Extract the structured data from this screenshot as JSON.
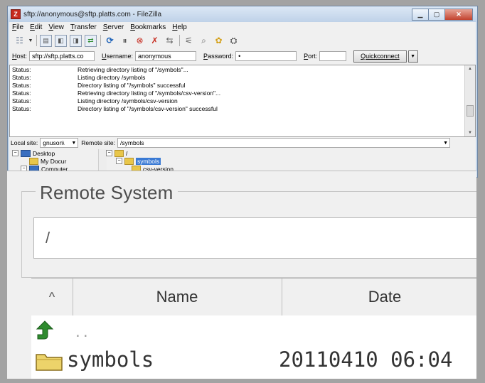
{
  "window": {
    "title": "sftp://anonymous@sftp.platts.com - FileZilla",
    "app_icon_letter": "Z"
  },
  "menu": [
    "File",
    "Edit",
    "View",
    "Transfer",
    "Server",
    "Bookmarks",
    "Help"
  ],
  "connect": {
    "host_label": "Host:",
    "host_value": "sftp://sftp.platts.co",
    "user_label": "Username:",
    "user_value": "anonymous",
    "pass_label": "Password:",
    "pass_value": "•",
    "port_label": "Port:",
    "port_value": "",
    "quickconnect_label": "Quickconnect"
  },
  "log": [
    {
      "k": "Status:",
      "v": "Retrieving directory listing of \"/symbols\"..."
    },
    {
      "k": "Status:",
      "v": "Listing directory /symbols"
    },
    {
      "k": "Status:",
      "v": "Directory listing of \"/symbols\" successful"
    },
    {
      "k": "Status:",
      "v": "Retrieving directory listing of \"/symbols/csv-version\"..."
    },
    {
      "k": "Status:",
      "v": "Listing directory /symbols/csv-version"
    },
    {
      "k": "Status:",
      "v": "Directory listing of \"/symbols/csv-version\" successful"
    }
  ],
  "local": {
    "label": "Local site:",
    "value": "gnuson\\",
    "tree": [
      "Desktop",
      "My Docur",
      "Computer"
    ]
  },
  "remote": {
    "label": "Remote site:",
    "value": "/symbols",
    "tree": [
      "/",
      "symbols",
      "csv-version"
    ]
  },
  "zoom": {
    "group_label": "Remote System",
    "path_value": "/",
    "columns": [
      "Name",
      "Date"
    ],
    "parent_label": "..",
    "row": {
      "name": "symbols",
      "date": "20110410 06:04"
    }
  },
  "colors": {
    "selection": "#3a7ad4",
    "folder": "#e8c64a",
    "up_arrow": "#2e8b2e"
  }
}
